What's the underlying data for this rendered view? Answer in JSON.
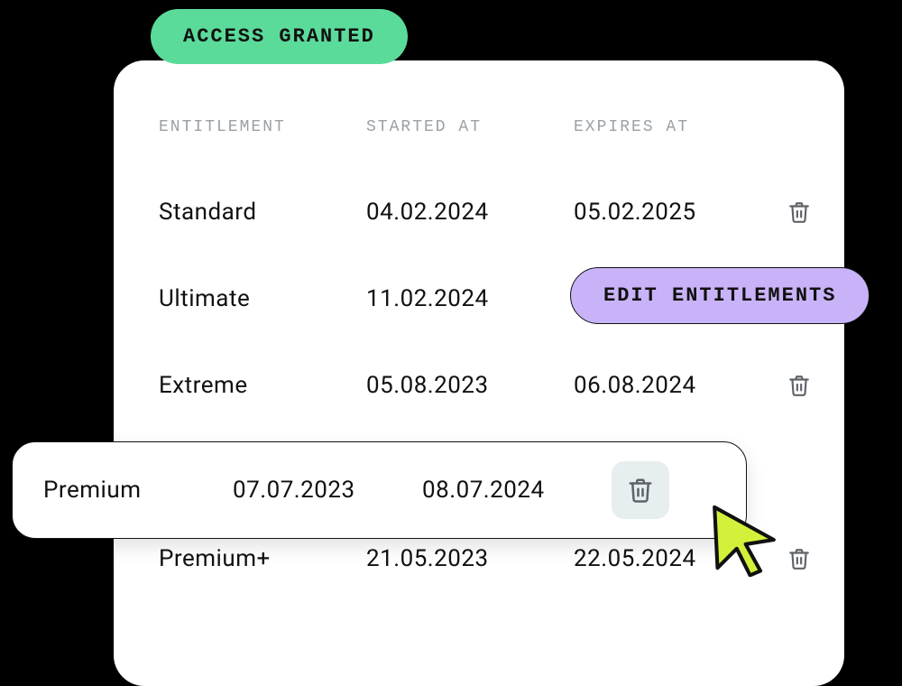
{
  "badges": {
    "access_granted": "ACCESS GRANTED",
    "edit_entitlements": "EDIT ENTITLEMENTS"
  },
  "table": {
    "headers": {
      "entitlement": "ENTITLEMENT",
      "started_at": "STARTED AT",
      "expires_at": "EXPIRES AT"
    },
    "rows": [
      {
        "name": "Standard",
        "started": "04.02.2024",
        "expires": "05.02.2025"
      },
      {
        "name": "Ultimate",
        "started": "11.02.2024",
        "expires": ""
      },
      {
        "name": "Extreme",
        "started": "05.08.2023",
        "expires": "06.08.2024"
      },
      {
        "name": "Premium",
        "started": "07.07.2023",
        "expires": "08.07.2024"
      },
      {
        "name": "Premium+",
        "started": "21.05.2023",
        "expires": "22.05.2024"
      }
    ],
    "highlighted_index": 3
  }
}
